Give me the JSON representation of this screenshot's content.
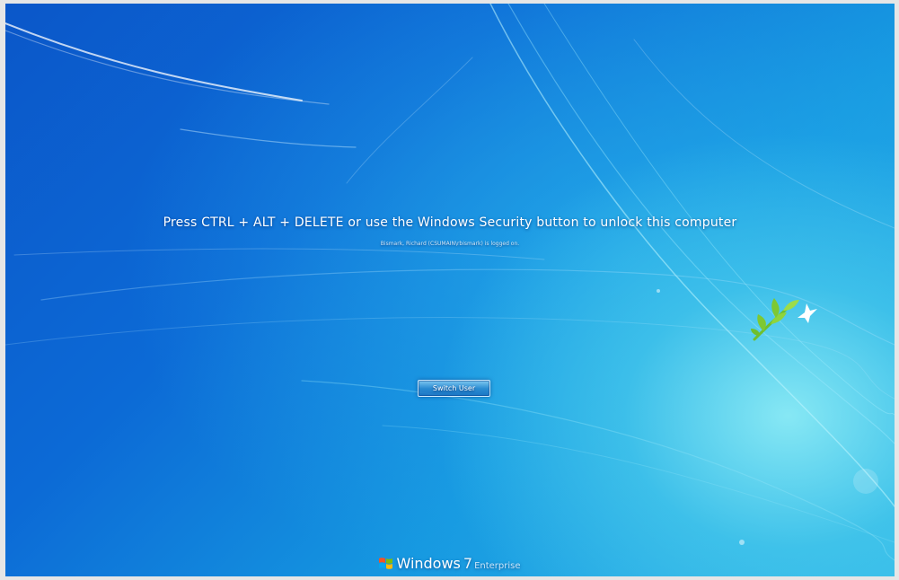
{
  "lock_screen": {
    "message": "Press CTRL + ALT + DELETE or use the Windows Security button to unlock this computer",
    "logged_on_text": "Bismark, Richard (CSUMAIN\\rbismark) is logged on.",
    "switch_user_label": "Switch User"
  },
  "branding": {
    "logo_icon": "windows-flag-icon",
    "name": "Windows",
    "version": "7",
    "edition": "Enterprise"
  },
  "decoration": {
    "wallpaper_icon": "bird-on-branch-icon"
  },
  "colors": {
    "background_dark": "#0b57c9",
    "background_light": "#30b8e8",
    "text": "#ffffff",
    "leaf_green": "#7ec832"
  }
}
